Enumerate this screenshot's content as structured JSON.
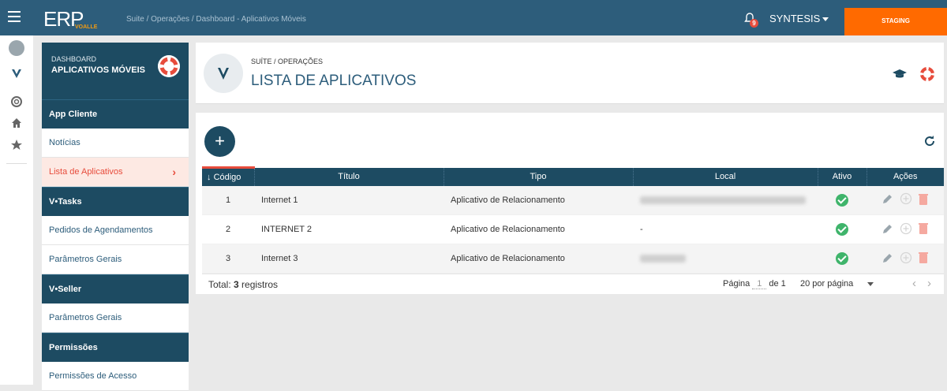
{
  "topbar": {
    "logo": "ERP",
    "logo_sub": "VOALLE",
    "breadcrumb": "Suite  /  Operações  /  Dashboard - Aplicativos Móveis",
    "notification_count": "9",
    "user": "SYNTESIS",
    "env_label": "STAGING"
  },
  "sidebar": {
    "header_small": "DASHBOARD",
    "header_title": "APLICATIVOS MÓVEIS",
    "sections": [
      {
        "title": "App Cliente",
        "items": [
          "Notícias",
          "Lista de Aplicativos"
        ]
      },
      {
        "title": "V•Tasks",
        "items": [
          "Pedidos de Agendamentos",
          "Parâmetros Gerais"
        ]
      },
      {
        "title": "V•Seller",
        "items": [
          "Parâmetros Gerais"
        ]
      },
      {
        "title": "Permissões",
        "items": [
          "Permissões de Acesso"
        ]
      }
    ],
    "active_item": "Lista de Aplicativos"
  },
  "page": {
    "breadcrumb": "SUÍTE / OPERAÇÕES",
    "title": "LISTA DE APLICATIVOS"
  },
  "table": {
    "columns": [
      "Código",
      "Título",
      "Tipo",
      "Local",
      "Ativo",
      "Ações"
    ],
    "rows": [
      {
        "code": "1",
        "title": "Internet 1",
        "type": "Aplicativo de Relacionamento",
        "local": "",
        "active": true
      },
      {
        "code": "2",
        "title": "INTERNET 2",
        "type": "Aplicativo de Relacionamento",
        "local": "-",
        "active": true
      },
      {
        "code": "3",
        "title": "Internet 3",
        "type": "Aplicativo de Relacionamento",
        "local": "",
        "active": true
      }
    ]
  },
  "footer": {
    "total_prefix": "Total: ",
    "total_count": "3",
    "total_suffix": " registros",
    "page_label": "Página",
    "page_current": "1",
    "page_of": "de 1",
    "per_page": "20 por página"
  },
  "colors": {
    "topbar": "#2d5d7b",
    "sidebar_dark": "#1d4b62",
    "accent": "#e74c3c",
    "staging": "#ff6a00",
    "active_green": "#3fb46b"
  }
}
